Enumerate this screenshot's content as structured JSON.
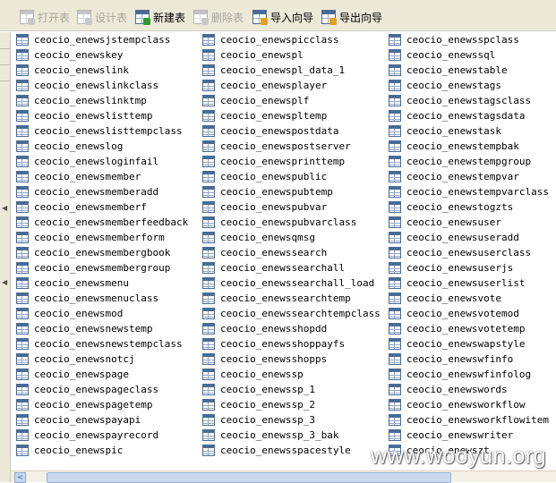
{
  "toolbar": {
    "open_label": "打开表",
    "design_label": "设计表",
    "new_label": "新建表",
    "delete_label": "删除表",
    "import_label": "导入向导",
    "export_label": "导出向导"
  },
  "tables": [
    [
      "ceocio_enewsjstempclass",
      "ceocio_enewskey",
      "ceocio_enewslink",
      "ceocio_enewslinkclass",
      "ceocio_enewslinktmp",
      "ceocio_enewslisttemp",
      "ceocio_enewslisttempclass",
      "ceocio_enewslog",
      "ceocio_enewsloginfail",
      "ceocio_enewsmember",
      "ceocio_enewsmemberadd",
      "ceocio_enewsmemberf",
      "ceocio_enewsmemberfeedback",
      "ceocio_enewsmemberform",
      "ceocio_enewsmembergbook",
      "ceocio_enewsmembergroup",
      "ceocio_enewsmenu",
      "ceocio_enewsmenuclass",
      "ceocio_enewsmod",
      "ceocio_enewsnewstemp",
      "ceocio_enewsnewstempclass",
      "ceocio_enewsnotcj",
      "ceocio_enewspage",
      "ceocio_enewspageclass",
      "ceocio_enewspagetemp",
      "ceocio_enewspayapi",
      "ceocio_enewspayrecord",
      "ceocio_enewspic"
    ],
    [
      "ceocio_enewspicclass",
      "ceocio_enewspl",
      "ceocio_enewspl_data_1",
      "ceocio_enewsplayer",
      "ceocio_enewsplf",
      "ceocio_enewspltemp",
      "ceocio_enewspostdata",
      "ceocio_enewspostserver",
      "ceocio_enewsprinttemp",
      "ceocio_enewspublic",
      "ceocio_enewspubtemp",
      "ceocio_enewspubvar",
      "ceocio_enewspubvarclass",
      "ceocio_enewsqmsg",
      "ceocio_enewssearch",
      "ceocio_enewssearchall",
      "ceocio_enewssearchall_load",
      "ceocio_enewssearchtemp",
      "ceocio_enewssearchtempclass",
      "ceocio_enewsshopdd",
      "ceocio_enewsshoppayfs",
      "ceocio_enewsshopps",
      "ceocio_enewssp",
      "ceocio_enewssp_1",
      "ceocio_enewssp_2",
      "ceocio_enewssp_3",
      "ceocio_enewssp_3_bak",
      "ceocio_enewsspacestyle"
    ],
    [
      "ceocio_enewsspclass",
      "ceocio_enewssql",
      "ceocio_enewstable",
      "ceocio_enewstags",
      "ceocio_enewstagsclass",
      "ceocio_enewstagsdata",
      "ceocio_enewstask",
      "ceocio_enewstempbak",
      "ceocio_enewstempgroup",
      "ceocio_enewstempvar",
      "ceocio_enewstempvarclass",
      "ceocio_enewstogzts",
      "ceocio_enewsuser",
      "ceocio_enewsuseradd",
      "ceocio_enewsuserclass",
      "ceocio_enewsuserjs",
      "ceocio_enewsuserlist",
      "ceocio_enewsvote",
      "ceocio_enewsvotemod",
      "ceocio_enewsvotetemp",
      "ceocio_enewswapstyle",
      "ceocio_enewswfinfo",
      "ceocio_enewswfinfolog",
      "ceocio_enewswords",
      "ceocio_enewsworkflow",
      "ceocio_enewsworkflowitem",
      "ceocio_enewswriter",
      "ceocio_enewszt"
    ]
  ],
  "watermark": "www.wooyun.org",
  "scroll_left_glyph": "<",
  "left_arrow_glyph": "◀"
}
